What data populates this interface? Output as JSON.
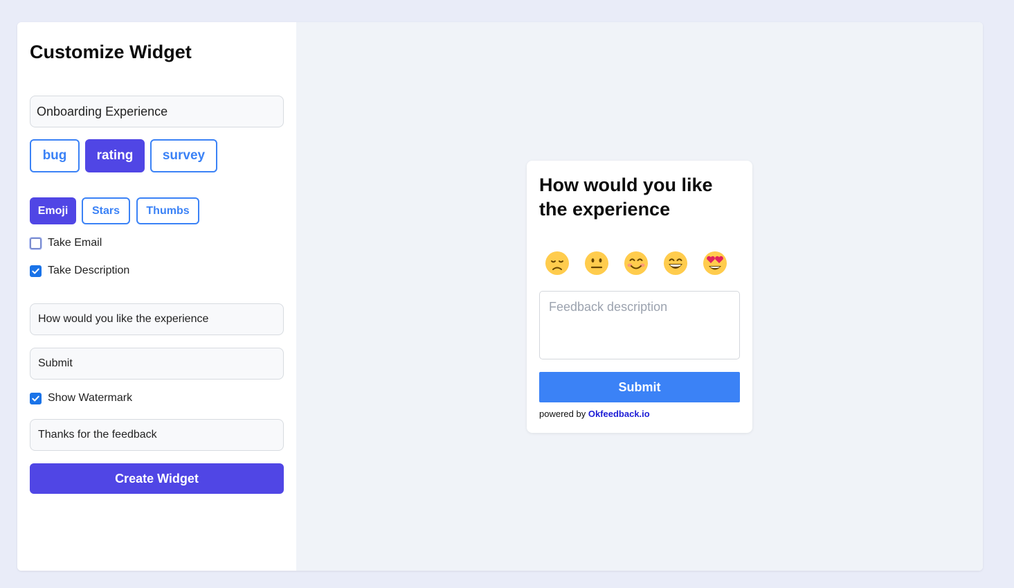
{
  "sidebar": {
    "title": "Customize Widget",
    "widget_name_value": "Onboarding Experience",
    "type_options": [
      {
        "label": "bug",
        "active": false
      },
      {
        "label": "rating",
        "active": true
      },
      {
        "label": "survey",
        "active": false
      }
    ],
    "rating_styles": [
      {
        "label": "Emoji",
        "active": true
      },
      {
        "label": "Stars",
        "active": false
      },
      {
        "label": "Thumbs",
        "active": false
      }
    ],
    "take_email": {
      "label": "Take Email",
      "checked": false
    },
    "take_description": {
      "label": "Take Description",
      "checked": true
    },
    "question_value": "How would you like the experience",
    "submit_label_value": "Submit",
    "show_watermark": {
      "label": "Show Watermark",
      "checked": true
    },
    "thanks_value": "Thanks for the feedback",
    "create_button": "Create Widget"
  },
  "preview": {
    "question": "How would you like the experience",
    "emojis": [
      "disappointed-face-icon",
      "neutral-face-icon",
      "smiling-face-icon",
      "grinning-face-icon",
      "heart-eyes-face-icon"
    ],
    "description_placeholder": "Feedback description",
    "submit": "Submit",
    "powered_by_prefix": "powered by",
    "powered_by_link": "Okfeedback.io"
  },
  "colors": {
    "primary": "#5046e5",
    "accent_blue": "#3b82f6",
    "background": "#e9ecf8",
    "preview_bg": "#f0f3f8"
  }
}
